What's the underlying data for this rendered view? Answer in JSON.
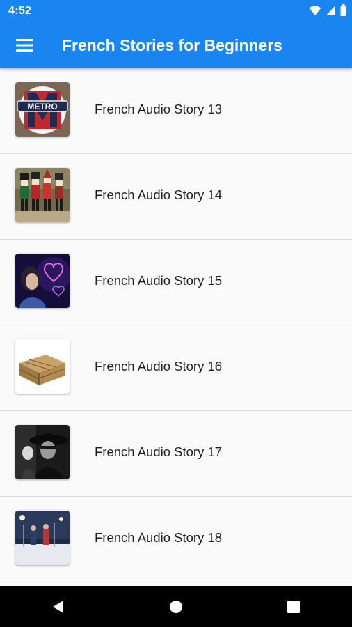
{
  "status_bar": {
    "time": "4:52",
    "icons": [
      "wifi-icon",
      "cell-signal-icon",
      "battery-icon"
    ]
  },
  "app_bar": {
    "title": "French Stories for Beginners",
    "menu_icon": "hamburger-menu-icon",
    "color": "#1a84f0"
  },
  "stories": [
    {
      "label": "French Audio Story 13",
      "thumbnail": "metro-sign-image",
      "thumb_text": "METRO"
    },
    {
      "label": "French Audio Story 14",
      "thumbnail": "nutcracker-figures-image"
    },
    {
      "label": "French Audio Story 15",
      "thumbnail": "woman-with-neon-hearts-image"
    },
    {
      "label": "French Audio Story 16",
      "thumbnail": "wooden-crate-image"
    },
    {
      "label": "French Audio Story 17",
      "thumbnail": "woman-in-hat-black-white-image"
    },
    {
      "label": "French Audio Story 18",
      "thumbnail": "couple-in-snow-night-image"
    }
  ],
  "nav_bar": {
    "buttons": [
      "back-icon",
      "home-icon",
      "recents-icon"
    ]
  }
}
